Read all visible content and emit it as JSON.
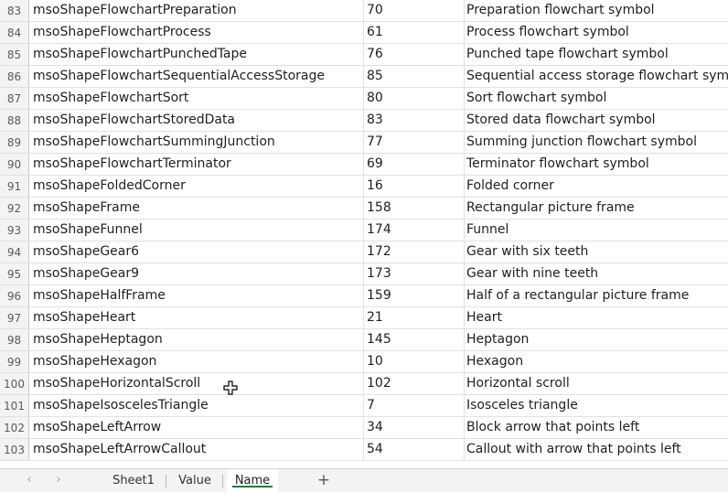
{
  "rows": [
    {
      "num": "83",
      "name": "msoShapeFlowchartPreparation",
      "value": "70",
      "desc": "Preparation flowchart symbol"
    },
    {
      "num": "84",
      "name": "msoShapeFlowchartProcess",
      "value": "61",
      "desc": "Process flowchart symbol"
    },
    {
      "num": "85",
      "name": "msoShapeFlowchartPunchedTape",
      "value": "76",
      "desc": "Punched tape flowchart symbol"
    },
    {
      "num": "86",
      "name": "msoShapeFlowchartSequentialAccessStorage",
      "value": "85",
      "desc": "Sequential access storage flowchart symbol"
    },
    {
      "num": "87",
      "name": "msoShapeFlowchartSort",
      "value": "80",
      "desc": "Sort flowchart symbol"
    },
    {
      "num": "88",
      "name": "msoShapeFlowchartStoredData",
      "value": "83",
      "desc": "Stored data flowchart symbol"
    },
    {
      "num": "89",
      "name": "msoShapeFlowchartSummingJunction",
      "value": "77",
      "desc": "Summing junction flowchart symbol"
    },
    {
      "num": "90",
      "name": "msoShapeFlowchartTerminator",
      "value": "69",
      "desc": "Terminator flowchart symbol"
    },
    {
      "num": "91",
      "name": "msoShapeFoldedCorner",
      "value": "16",
      "desc": "Folded corner"
    },
    {
      "num": "92",
      "name": "msoShapeFrame",
      "value": "158",
      "desc": "Rectangular picture frame"
    },
    {
      "num": "93",
      "name": "msoShapeFunnel",
      "value": "174",
      "desc": "Funnel"
    },
    {
      "num": "94",
      "name": "msoShapeGear6",
      "value": "172",
      "desc": "Gear with six teeth"
    },
    {
      "num": "95",
      "name": "msoShapeGear9",
      "value": "173",
      "desc": "Gear with nine teeth"
    },
    {
      "num": "96",
      "name": "msoShapeHalfFrame",
      "value": "159",
      "desc": "Half of a rectangular picture frame"
    },
    {
      "num": "97",
      "name": "msoShapeHeart",
      "value": "21",
      "desc": "Heart"
    },
    {
      "num": "98",
      "name": "msoShapeHeptagon",
      "value": "145",
      "desc": "Heptagon"
    },
    {
      "num": "99",
      "name": "msoShapeHexagon",
      "value": "10",
      "desc": "Hexagon"
    },
    {
      "num": "100",
      "name": "msoShapeHorizontalScroll",
      "value": "102",
      "desc": "Horizontal scroll"
    },
    {
      "num": "101",
      "name": "msoShapeIsoscelesTriangle",
      "value": "7",
      "desc": "Isosceles triangle"
    },
    {
      "num": "102",
      "name": "msoShapeLeftArrow",
      "value": "34",
      "desc": "Block arrow that points left"
    },
    {
      "num": "103",
      "name": "msoShapeLeftArrowCallout",
      "value": "54",
      "desc": "Callout with arrow that points left"
    }
  ],
  "tabs": {
    "prev_icon": "‹",
    "next_icon": "›",
    "sheet1": "Sheet1",
    "value": "Value",
    "name": "Name",
    "add_icon": "+"
  }
}
